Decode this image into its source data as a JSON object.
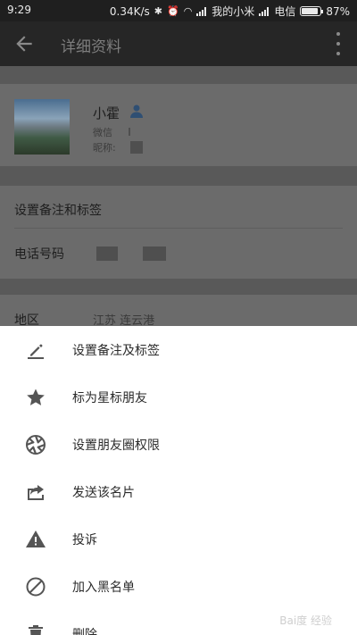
{
  "status_bar": {
    "time": "9:29",
    "speed": "0.34K/s",
    "carrier1": "我的小米",
    "carrier2": "电信",
    "battery": "87%",
    "battery_level": 0.87
  },
  "toolbar": {
    "title": "详细资料"
  },
  "profile": {
    "name": "小霍",
    "wechat_label": "微信",
    "nickname_label": "昵称:"
  },
  "rows": {
    "remark": "设置备注和标签",
    "phone": "电话号码",
    "region_label": "地区",
    "region_value": "江苏  连云港"
  },
  "menu": {
    "items": [
      {
        "label": "设置备注及标签",
        "icon": "pencil-icon"
      },
      {
        "label": "标为星标朋友",
        "icon": "star-icon"
      },
      {
        "label": "设置朋友圈权限",
        "icon": "aperture-icon"
      },
      {
        "label": "发送该名片",
        "icon": "share-icon"
      },
      {
        "label": "投诉",
        "icon": "warning-icon"
      },
      {
        "label": "加入黑名单",
        "icon": "block-icon"
      },
      {
        "label": "删除",
        "icon": "trash-icon"
      }
    ]
  },
  "watermark": "Bai度 经验"
}
